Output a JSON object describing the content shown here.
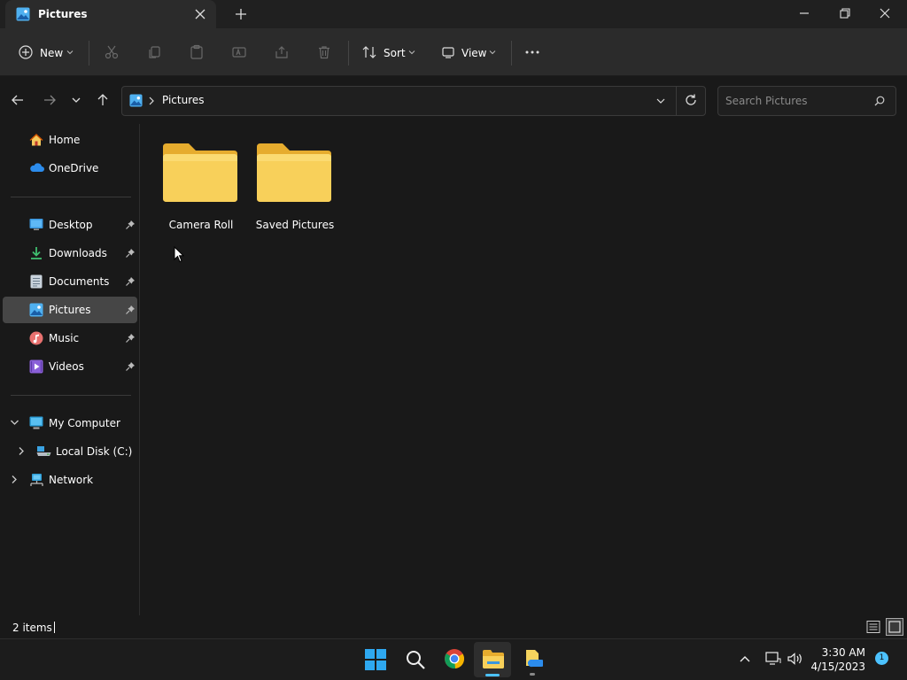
{
  "window": {
    "tab_title": "Pictures"
  },
  "toolbar": {
    "new_label": "New",
    "sort_label": "Sort",
    "view_label": "View"
  },
  "address": {
    "path": [
      "Pictures"
    ]
  },
  "search": {
    "placeholder": "Search Pictures"
  },
  "sidebar": {
    "quick": [
      {
        "label": "Home",
        "icon": "home-icon"
      },
      {
        "label": "OneDrive",
        "icon": "onedrive-icon"
      }
    ],
    "pinned": [
      {
        "label": "Desktop",
        "icon": "desktop-icon"
      },
      {
        "label": "Downloads",
        "icon": "downloads-icon"
      },
      {
        "label": "Documents",
        "icon": "documents-icon"
      },
      {
        "label": "Pictures",
        "icon": "pictures-icon",
        "selected": true
      },
      {
        "label": "Music",
        "icon": "music-icon"
      },
      {
        "label": "Videos",
        "icon": "videos-icon"
      }
    ],
    "tree": [
      {
        "label": "My Computer",
        "icon": "computer-icon",
        "expanded": true
      },
      {
        "label": "Local Disk (C:)",
        "icon": "drive-icon"
      },
      {
        "label": "Network",
        "icon": "network-icon"
      }
    ]
  },
  "content": {
    "folders": [
      {
        "name": "Camera Roll"
      },
      {
        "name": "Saved Pictures"
      }
    ]
  },
  "status": {
    "item_count": "2 items"
  },
  "taskbar": {
    "time": "3:30 AM",
    "date": "4/15/2023",
    "notification_count": "1"
  },
  "colors": {
    "folder_yellow": "#f8d05a",
    "accent_blue": "#4cc2ff",
    "selected_bg": "#464646"
  }
}
